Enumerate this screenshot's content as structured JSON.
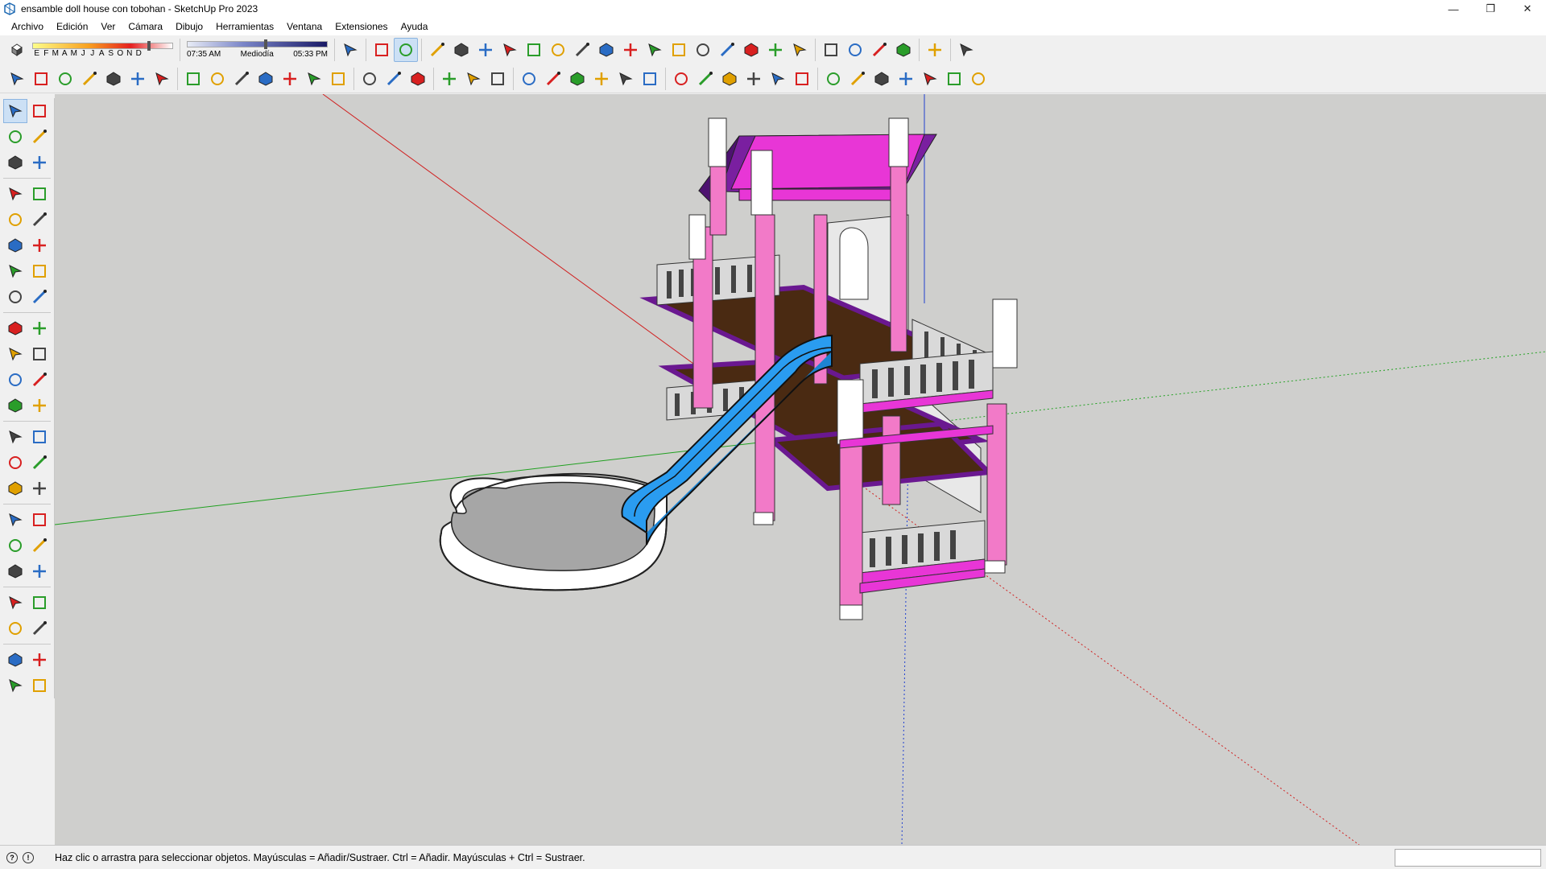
{
  "window": {
    "title": "ensamble doll house con tobohan - SketchUp Pro 2023",
    "controls": [
      "—",
      "❐",
      "✕"
    ]
  },
  "menu": [
    "Archivo",
    "Edición",
    "Ver",
    "Cámara",
    "Dibujo",
    "Herramientas",
    "Ventana",
    "Extensiones",
    "Ayuda"
  ],
  "shadows": {
    "months": [
      "E",
      "F",
      "M",
      "A",
      "M",
      "J",
      "J",
      "A",
      "S",
      "O",
      "N",
      "D"
    ],
    "time_start": "07:35 AM",
    "time_mid": "Mediodía",
    "time_end": "05:33 PM",
    "date_position": 0.82,
    "time_position": 0.55
  },
  "toolbar1_icons": [
    "shadows-icon",
    "search-icon",
    "select-icon",
    "eraser-icon",
    "pencil-icon",
    "arc-icon",
    "rectangle-icon",
    "push-pull-icon",
    "follow-me-icon",
    "move-icon",
    "rotate-icon",
    "scale-icon",
    "offset-icon",
    "tape-measure-icon",
    "paint-bucket-icon",
    "orbit-icon",
    "pan-icon",
    "zoom-icon",
    "zoom-extents-icon",
    "warehouse-icon",
    "sandbox-icon",
    "layers-icon",
    "extension-icon",
    "account-icon",
    "layout-icon"
  ],
  "toolbar2_icons": [
    "xray-icon",
    "back-edges-icon",
    "wireframe-icon",
    "hidden-line-icon",
    "shaded-icon",
    "shaded-textures-icon",
    "monochrome-icon",
    "iso-icon",
    "top-icon",
    "front-icon",
    "right-icon",
    "back-icon",
    "left-icon",
    "bottom-icon",
    "component-icon",
    "outliner-icon",
    "tag-icon",
    "section-plane-icon",
    "section-display-icon",
    "section-cut-icon",
    "outer-shell-icon",
    "intersect-icon",
    "union-icon",
    "subtract-icon",
    "trim-icon",
    "split-icon",
    "add-location-icon",
    "photo-texture-icon",
    "geo-icon",
    "model-info-icon",
    "scene-icon",
    "lock-icon",
    "play-icon",
    "record-icon",
    "frame-icon",
    "stop-icon",
    "timer-icon",
    "film-icon",
    "help-icon"
  ],
  "left_palette_icons": [
    [
      "select-icon",
      "lasso-icon"
    ],
    [
      "paint-bucket-icon",
      "eraser-icon"
    ],
    [
      "make-component-icon",
      "tag-eraser-icon"
    ],
    [
      "pencil-icon",
      "freehand-icon"
    ],
    [
      "rectangle-icon",
      "rotated-rectangle-icon"
    ],
    [
      "circle-icon",
      "polygon-icon"
    ],
    [
      "arc-icon",
      "two-point-arc-icon"
    ],
    [
      "three-point-arc-icon",
      "pie-icon"
    ],
    [
      "move-icon",
      "push-pull-icon"
    ],
    [
      "rotate-icon",
      "follow-me-icon"
    ],
    [
      "scale-icon",
      "offset-icon"
    ],
    [
      "axes-icon",
      "protractor-icon"
    ],
    [
      "tape-measure-icon",
      "dimension-icon"
    ],
    [
      "protractor2-icon",
      "text-icon"
    ],
    [
      "axes2-icon",
      "3d-text-icon"
    ],
    [
      "orbit-icon",
      "pan-icon"
    ],
    [
      "zoom-icon",
      "zoom-window-icon"
    ],
    [
      "zoom-extents-icon",
      "previous-view-icon"
    ],
    [
      "position-camera-icon",
      "walk-icon"
    ],
    [
      "look-around-icon",
      "section-plane-icon"
    ],
    [
      "sandbox-icon",
      "smoove-icon"
    ],
    [
      "layers-icon",
      "extension-icon"
    ]
  ],
  "status": {
    "text": "Haz clic o arrastra para seleccionar objetos. Mayúsculas = Añadir/Sustraer. Ctrl = Añadir. Mayúsculas + Ctrl = Sustraer.",
    "icons": [
      "?",
      "!"
    ]
  },
  "colors": {
    "viewport": "#cfcfcd",
    "pink": "#f27ac8",
    "magenta": "#e836d6",
    "purple": "#7a1fa0",
    "floor": "#4a2a12",
    "slide": "#2a9cf0",
    "rail": "#d8d8d8"
  }
}
